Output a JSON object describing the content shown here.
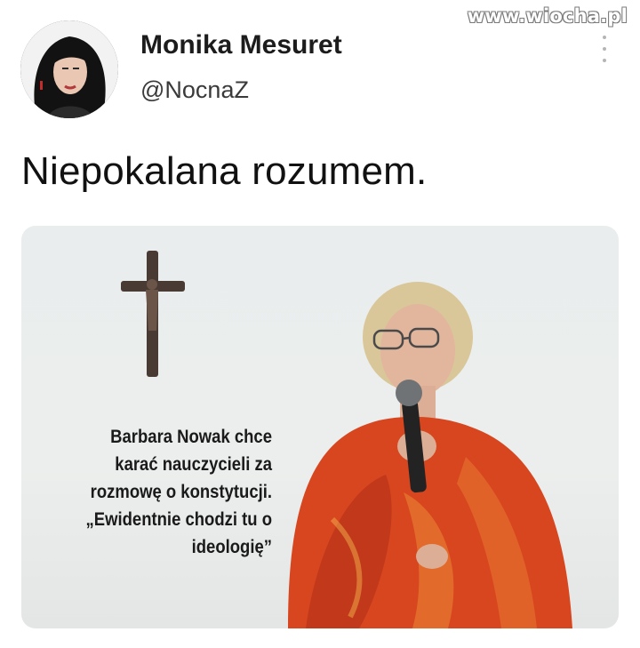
{
  "watermark": "www.wiocha.pl",
  "tweet": {
    "author_name": "Monika Mesuret",
    "author_handle": "@NocnaZ",
    "text": "Niepokalana rozumem."
  },
  "media": {
    "caption_lines": [
      "Barbara Nowak chce",
      "karać nauczycieli za",
      "rozmowę o konstytucji.",
      "„Ewidentnie chodzi tu o",
      "ideologię”"
    ]
  },
  "icons": {
    "more": "more-vertical-icon",
    "avatar": "avatar"
  },
  "colors": {
    "text": "#111111",
    "sweater": "#d8461f"
  }
}
